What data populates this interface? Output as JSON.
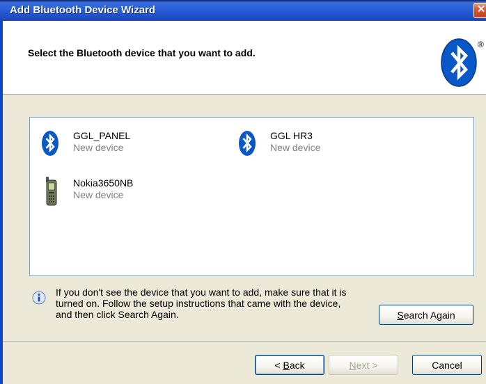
{
  "window": {
    "title": "Add Bluetooth Device Wizard",
    "close_glyph": "✕"
  },
  "header": {
    "heading": "Select the Bluetooth device that you want to add.",
    "registered_mark": "®",
    "logo_icon": "bluetooth-logo"
  },
  "devices": [
    {
      "name": "GGL_PANEL",
      "status": "New device",
      "icon": "bluetooth-icon"
    },
    {
      "name": "GGL HR3",
      "status": "New device",
      "icon": "bluetooth-icon"
    },
    {
      "name": "Nokia3650NB",
      "status": "New device",
      "icon": "mobile-phone-icon"
    }
  ],
  "info": {
    "icon": "info-icon",
    "line1": "If you don't see the device that you want to add, make sure that it is",
    "line2": "turned on. Follow the setup instructions that came with the device,",
    "line3": "and then click Search Again."
  },
  "buttons": {
    "search_again": {
      "mnemonic": "S",
      "rest": "earch Again"
    },
    "back": {
      "arrow": "< ",
      "mnemonic": "B",
      "rest": "ack"
    },
    "next": {
      "mnemonic": "N",
      "rest": "ext",
      "arrow": " >",
      "enabled": false
    },
    "cancel": "Cancel"
  },
  "colors": {
    "title_bar": "#2a5fd8",
    "bluetooth_blue": "#0a58c8",
    "dialog_bg": "#ece9d8"
  }
}
